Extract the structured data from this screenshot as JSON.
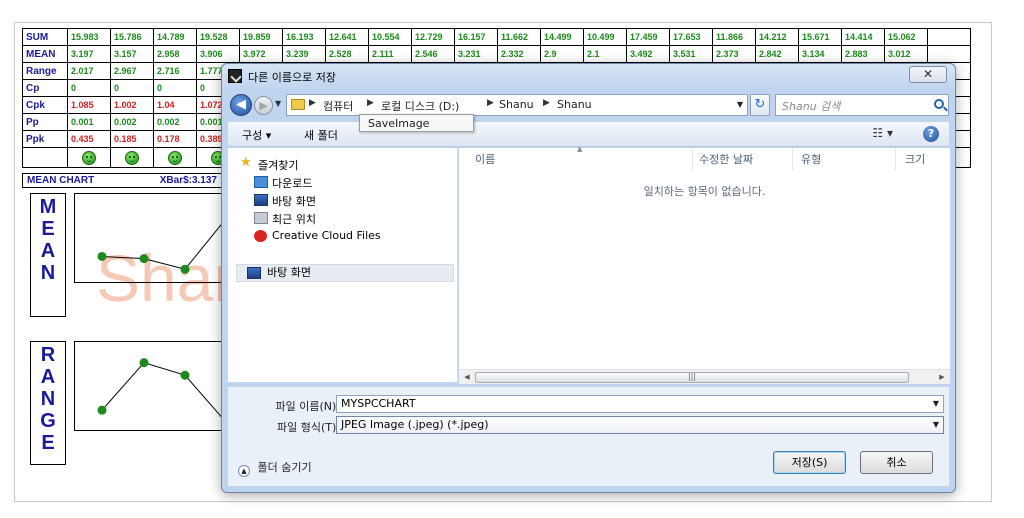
{
  "stats": {
    "rows": [
      {
        "label": "SUM",
        "style": "green",
        "values": [
          "15.983",
          "15.786",
          "14.789",
          "19.528",
          "19.859",
          "16.193",
          "12.641",
          "10.554",
          "12.729",
          "16.157",
          "11.662",
          "14.499",
          "10.499",
          "17.459",
          "17.653",
          "11.866",
          "14.212",
          "15.671",
          "14.414",
          "15.062",
          ""
        ]
      },
      {
        "label": "MEAN",
        "style": "green",
        "values": [
          "3.197",
          "3.157",
          "2.958",
          "3.906",
          "3.972",
          "3.239",
          "2.528",
          "2.111",
          "2.546",
          "3.231",
          "2.332",
          "2.9",
          "2.1",
          "3.492",
          "3.531",
          "2.373",
          "2.842",
          "3.134",
          "2.883",
          "3.012",
          ""
        ]
      },
      {
        "label": "Range",
        "style": "green",
        "values": [
          "2.017",
          "2.967",
          "2.716",
          "1.777"
        ]
      },
      {
        "label": "Cp",
        "style": "green",
        "values": [
          "0",
          "0",
          "0",
          "0"
        ]
      },
      {
        "label": "Cpk",
        "style": "red",
        "values": [
          "1.085",
          "1.002",
          "1.04",
          "1.072"
        ]
      },
      {
        "label": "Pp",
        "style": "green",
        "values": [
          "0.001",
          "0.002",
          "0.002",
          "0.001"
        ]
      },
      {
        "label": "Ppk",
        "style": "red",
        "values": [
          "0.435",
          "0.185",
          "0.178",
          "0.389"
        ]
      }
    ],
    "status_icon": "smiley-face-icon"
  },
  "mean_chart": {
    "title": "MEAN CHART",
    "xbar_label": "XBar$:3.137",
    "side_label": "MEAN",
    "points": [
      3.197,
      3.157,
      2.958,
      3.906
    ]
  },
  "range_chart": {
    "side_label": "RANGE",
    "points": [
      2.017,
      2.967,
      2.716,
      1.777
    ]
  },
  "watermark": "Shanu",
  "colors": {
    "point_color": "#1c8a1c",
    "label_blue": "#1a1a9c",
    "red_value": "#d42020",
    "watermark": "#f6c8b6"
  },
  "dialog": {
    "title": "다른 이름으로 저장",
    "close_label": "✕",
    "breadcrumbs": [
      "컴퓨터",
      "로컬 디스크 (D:)",
      "Shanu",
      "Shanu"
    ],
    "search_placeholder": "Shanu 검색",
    "organize_label": "구성 ▾",
    "new_folder_label": "새 폴더",
    "view_label": "☷ ▾",
    "help_label": "?",
    "tooltip": "SaveImage",
    "nav": {
      "favorites": "즐겨찾기",
      "downloads": "다운로드",
      "desktop": "바탕 화면",
      "recent": "최근 위치",
      "creative_cloud": "Creative Cloud Files",
      "desktop_root": "바탕 화면"
    },
    "columns": [
      "이름",
      "수정한 날짜",
      "유형",
      "크기"
    ],
    "empty_message": "일치하는 항목이 없습니다.",
    "filename_label": "파일 이름(N):",
    "filename_value": "MYSPCCHART",
    "filetype_label": "파일 형식(T):",
    "filetype_value": "JPEG Image (.jpeg) (*.jpeg)",
    "hide_folders_label": "폴더 숨기기",
    "save_label": "저장(S)",
    "cancel_label": "취소"
  }
}
